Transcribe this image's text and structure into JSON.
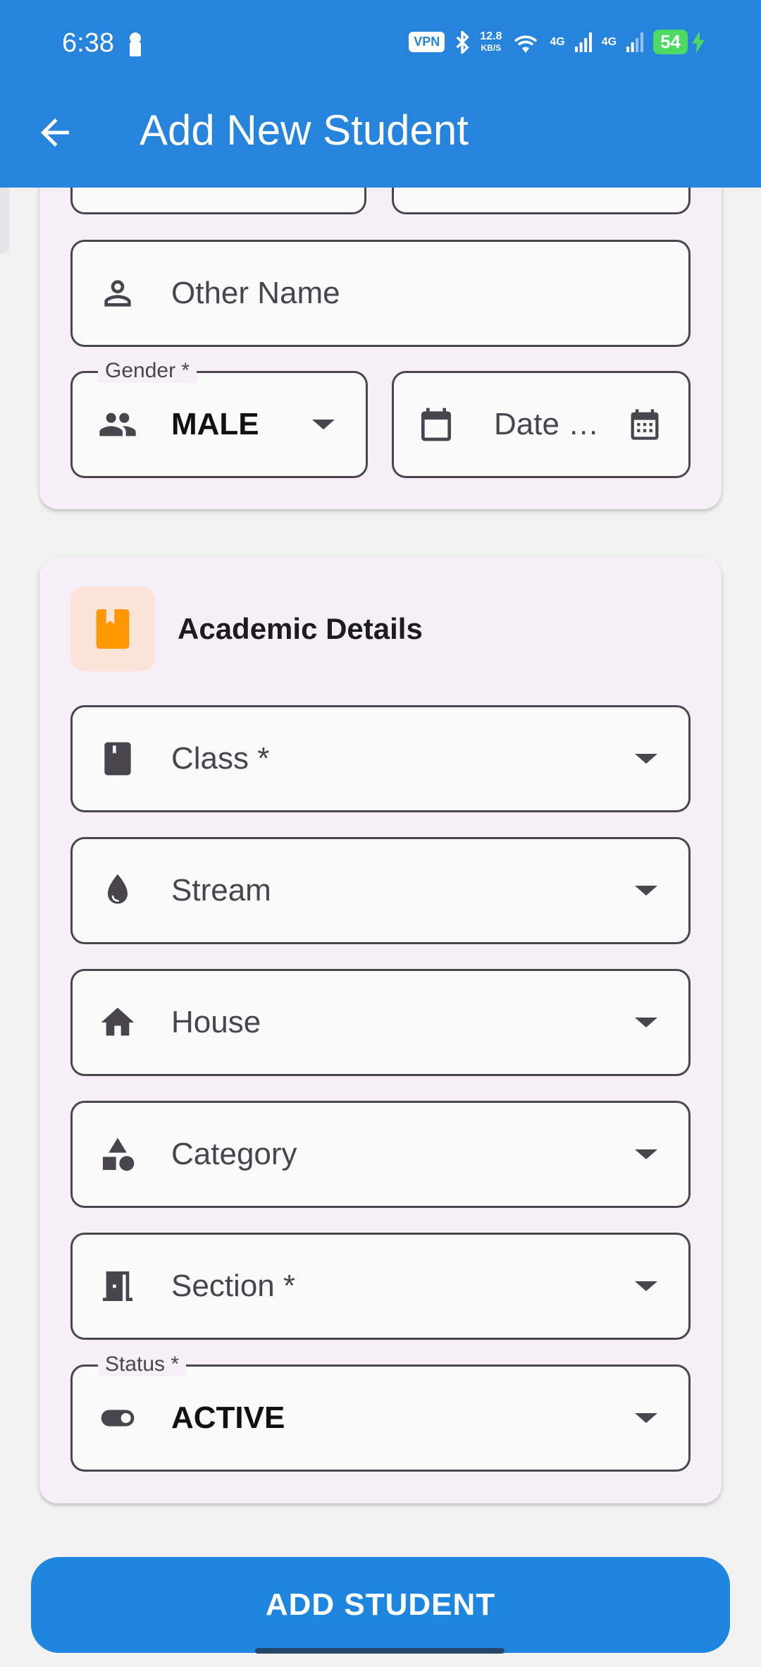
{
  "status_bar": {
    "time": "6:38",
    "vpn": "VPN",
    "speed_value": "12.8",
    "speed_unit": "KB/S",
    "net1": "4G",
    "net2": "4G",
    "battery": "54"
  },
  "app_bar": {
    "title": "Add New Student"
  },
  "personal": {
    "other_name_placeholder": "Other Name",
    "gender_label": "Gender *",
    "gender_value": "MALE",
    "dob_placeholder": "Date …"
  },
  "academic": {
    "section_title": "Academic Details",
    "class_label": "Class *",
    "stream_label": "Stream",
    "house_label": "House",
    "category_label": "Category",
    "section_label": "Section *",
    "status_label": "Status *",
    "status_value": "ACTIVE"
  },
  "actions": {
    "submit_label": "ADD STUDENT"
  },
  "colors": {
    "primary": "#2684dc",
    "button": "#1f86e0",
    "card": "#f6eff7",
    "accent_icon": "#ff9800"
  }
}
